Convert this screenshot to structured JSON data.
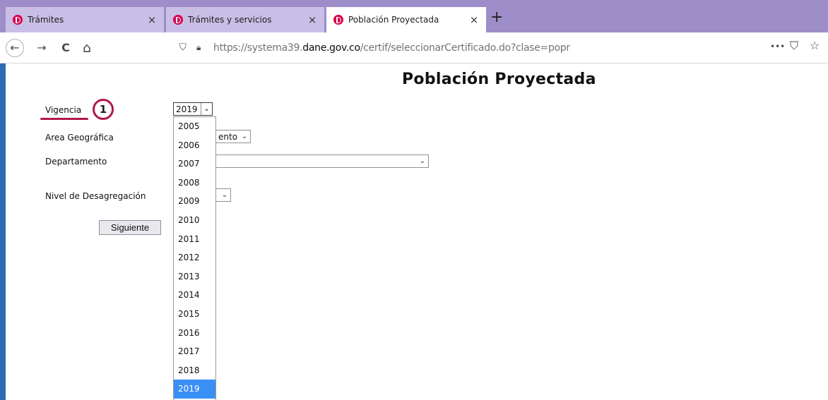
{
  "browser": {
    "tabs": [
      {
        "title": "Trámites",
        "active": false
      },
      {
        "title": "Trámites y servicios",
        "active": false
      },
      {
        "title": "Población Proyectada",
        "active": true
      }
    ],
    "close_glyph": "×",
    "new_tab_glyph": "+",
    "url_prefix": "https://systema39.",
    "url_domain": "dane.gov.co",
    "url_suffix": "/certif/seleccionarCertificado.do?clase=popr",
    "more_glyph": "•••",
    "pocket_glyph": "⛉",
    "bookmark_glyph": "☆",
    "back_glyph": "←",
    "forward_glyph": "→",
    "reload_glyph": "C",
    "home_glyph": "⌂"
  },
  "page": {
    "title": "Población Proyectada",
    "labels": {
      "vigencia": "Vigencia",
      "area": "Area Geográfica",
      "departamento": "Departamento",
      "nivel": "Nivel de Desagregación"
    },
    "annotation_number": "1",
    "year_select_value": "2019",
    "area_select_partial": "ento",
    "departamento_select_value": "",
    "nivel_select_value": "",
    "siguiente_label": "Siguiente",
    "year_options": [
      "2005",
      "2006",
      "2007",
      "2008",
      "2009",
      "2010",
      "2011",
      "2012",
      "2013",
      "2014",
      "2015",
      "2016",
      "2017",
      "2018",
      "2019"
    ],
    "selected_year": "2019"
  },
  "colors": {
    "tabbar": "#9d8ec9",
    "annotation": "#b0174f",
    "selected_option": "#3a8ff4"
  }
}
